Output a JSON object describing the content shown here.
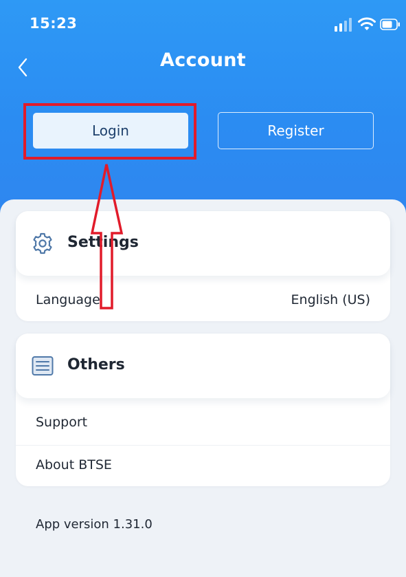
{
  "status_bar": {
    "time": "15:23",
    "icons": [
      "signal-icon",
      "wifi-icon",
      "battery-icon"
    ]
  },
  "header": {
    "back_icon": "chevron-left-icon",
    "title": "Account"
  },
  "auth": {
    "login_label": "Login",
    "register_label": "Register"
  },
  "settings": {
    "icon": "gear-icon",
    "title": "Settings",
    "items": [
      {
        "label": "Language",
        "value": "English (US)"
      }
    ]
  },
  "others": {
    "icon": "list-icon",
    "title": "Others",
    "items": [
      {
        "label": "Support"
      },
      {
        "label": "About BTSE"
      }
    ]
  },
  "footer": {
    "app_version": "App version 1.31.0"
  },
  "colors": {
    "header_blue": "#2b8cf2",
    "login_bg": "#e9f3fd",
    "annotation_red": "#e11b2a",
    "icon_blue": "#4f78a8"
  }
}
